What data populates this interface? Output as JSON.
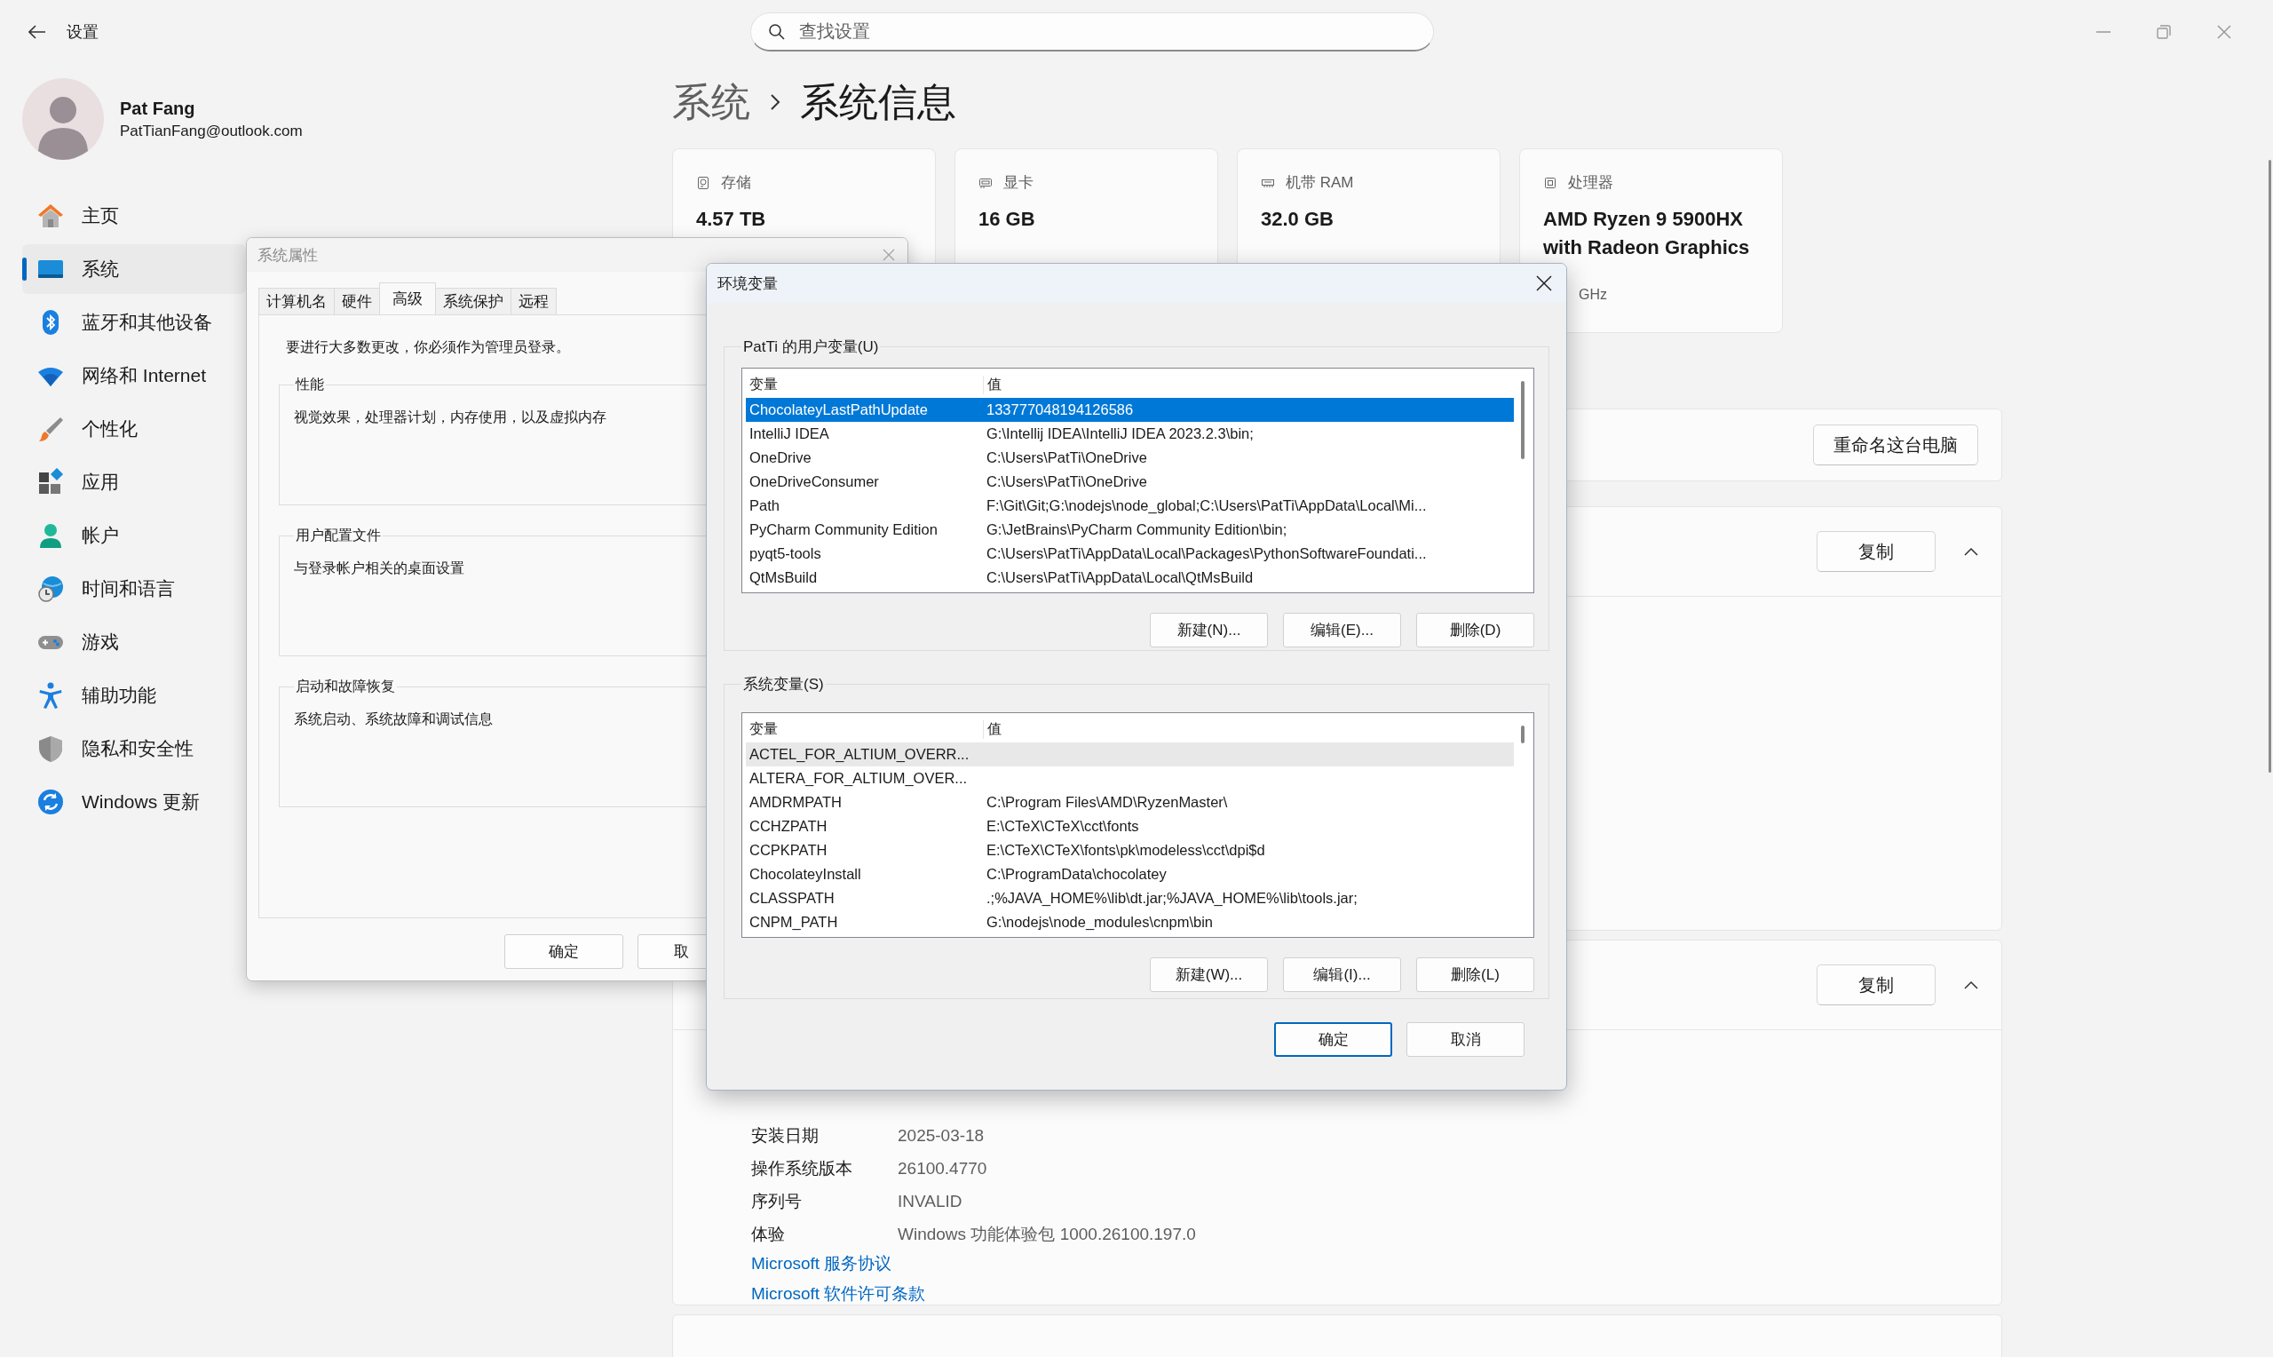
{
  "window": {
    "title": "设置"
  },
  "search": {
    "placeholder": "查找设置"
  },
  "account": {
    "name": "Pat Fang",
    "email": "PatTianFang@outlook.com"
  },
  "nav": [
    {
      "label": "主页",
      "selected": false
    },
    {
      "label": "系统",
      "selected": true
    },
    {
      "label": "蓝牙和其他设备",
      "selected": false
    },
    {
      "label": "网络和 Internet",
      "selected": false
    },
    {
      "label": "个性化",
      "selected": false
    },
    {
      "label": "应用",
      "selected": false
    },
    {
      "label": "帐户",
      "selected": false
    },
    {
      "label": "时间和语言",
      "selected": false
    },
    {
      "label": "游戏",
      "selected": false
    },
    {
      "label": "辅助功能",
      "selected": false
    },
    {
      "label": "隐私和安全性",
      "selected": false
    },
    {
      "label": "Windows 更新",
      "selected": false
    }
  ],
  "breadcrumb": {
    "parent": "系统",
    "current": "系统信息"
  },
  "cards": [
    {
      "label": "存储",
      "value": "4.57 TB"
    },
    {
      "label": "显卡",
      "value": "16 GB"
    },
    {
      "label": "机带 RAM",
      "value": "32.0 GB"
    },
    {
      "label": "处理器",
      "value": "AMD Ryzen 9 5900HX with Radeon Graphics",
      "detail": "GHz"
    }
  ],
  "rename_button": "重命名这台电脑",
  "sections": [
    {
      "copy_button": "复制",
      "expanded": true
    },
    {
      "copy_button": "复制",
      "expanded": true,
      "rows": [
        {
          "label": "安装日期",
          "value": "2025-03-18"
        },
        {
          "label": "操作系统版本",
          "value": "26100.4770"
        },
        {
          "label": "序列号",
          "value": "INVALID"
        },
        {
          "label": "体验",
          "value": "Windows 功能体验包 1000.26100.197.0"
        }
      ],
      "links": [
        "Microsoft 服务协议",
        "Microsoft 软件许可条款"
      ]
    }
  ],
  "system_properties": {
    "title": "系统属性",
    "tabs": [
      {
        "label": "计算机名",
        "selected": false
      },
      {
        "label": "硬件",
        "selected": false
      },
      {
        "label": "高级",
        "selected": true
      },
      {
        "label": "系统保护",
        "selected": false
      },
      {
        "label": "远程",
        "selected": false
      }
    ],
    "notice": "要进行大多数更改，你必须作为管理员登录。",
    "groups": [
      {
        "title": "性能",
        "text": "视觉效果，处理器计划，内存使用，以及虚拟内存"
      },
      {
        "title": "用户配置文件",
        "text": "与登录帐户相关的桌面设置"
      },
      {
        "title": "启动和故障恢复",
        "text": "系统启动、系统故障和调试信息"
      }
    ],
    "buttons": [
      "确定",
      "取"
    ]
  },
  "environment_variables": {
    "title": "环境变量",
    "groups": [
      {
        "title": "PatTi 的用户变量(U)",
        "columns": [
          "变量",
          "值"
        ],
        "rows": [
          {
            "name": "ChocolateyLastPathUpdate",
            "value": "133777048194126586",
            "selected": true,
            "hovered": false
          },
          {
            "name": "IntelliJ IDEA",
            "value": "G:\\Intellij IDEA\\IntelliJ IDEA 2023.2.3\\bin;",
            "selected": false,
            "hovered": false
          },
          {
            "name": "OneDrive",
            "value": "C:\\Users\\PatTi\\OneDrive",
            "selected": false,
            "hovered": false
          },
          {
            "name": "OneDriveConsumer",
            "value": "C:\\Users\\PatTi\\OneDrive",
            "selected": false,
            "hovered": false
          },
          {
            "name": "Path",
            "value": "F:\\Git\\Git;G:\\nodejs\\node_global;C:\\Users\\PatTi\\AppData\\Local\\Mi...",
            "selected": false,
            "hovered": false
          },
          {
            "name": "PyCharm Community Edition",
            "value": "G:\\JetBrains\\PyCharm Community Edition\\bin;",
            "selected": false,
            "hovered": false
          },
          {
            "name": "pyqt5-tools",
            "value": "C:\\Users\\PatTi\\AppData\\Local\\Packages\\PythonSoftwareFoundati...",
            "selected": false,
            "hovered": false
          },
          {
            "name": "QtMsBuild",
            "value": "C:\\Users\\PatTi\\AppData\\Local\\QtMsBuild",
            "selected": false,
            "hovered": false
          }
        ],
        "buttons": [
          "新建(N)...",
          "编辑(E)...",
          "删除(D)"
        ]
      },
      {
        "title": "系统变量(S)",
        "columns": [
          "变量",
          "值"
        ],
        "rows": [
          {
            "name": "ACTEL_FOR_ALTIUM_OVERR...",
            "value": "",
            "selected": false,
            "hovered": true
          },
          {
            "name": "ALTERA_FOR_ALTIUM_OVER...",
            "value": "",
            "selected": false,
            "hovered": false
          },
          {
            "name": "AMDRMPATH",
            "value": "C:\\Program Files\\AMD\\RyzenMaster\\",
            "selected": false,
            "hovered": false
          },
          {
            "name": "CCHZPATH",
            "value": "E:\\CTeX\\CTeX\\cct\\fonts",
            "selected": false,
            "hovered": false
          },
          {
            "name": "CCPKPATH",
            "value": "E:\\CTeX\\CTeX\\fonts\\pk\\modeless\\cct\\dpi$d",
            "selected": false,
            "hovered": false
          },
          {
            "name": "ChocolateyInstall",
            "value": "C:\\ProgramData\\chocolatey",
            "selected": false,
            "hovered": false
          },
          {
            "name": "CLASSPATH",
            "value": ".;%JAVA_HOME%\\lib\\dt.jar;%JAVA_HOME%\\lib\\tools.jar;",
            "selected": false,
            "hovered": false
          },
          {
            "name": "CNPM_PATH",
            "value": "G:\\nodejs\\node_modules\\cnpm\\bin",
            "selected": false,
            "hovered": false
          }
        ],
        "buttons": [
          "新建(W)...",
          "编辑(I)...",
          "删除(L)"
        ]
      }
    ],
    "buttons": [
      {
        "label": "确定",
        "default": true
      },
      {
        "label": "取消",
        "default": false
      }
    ]
  }
}
